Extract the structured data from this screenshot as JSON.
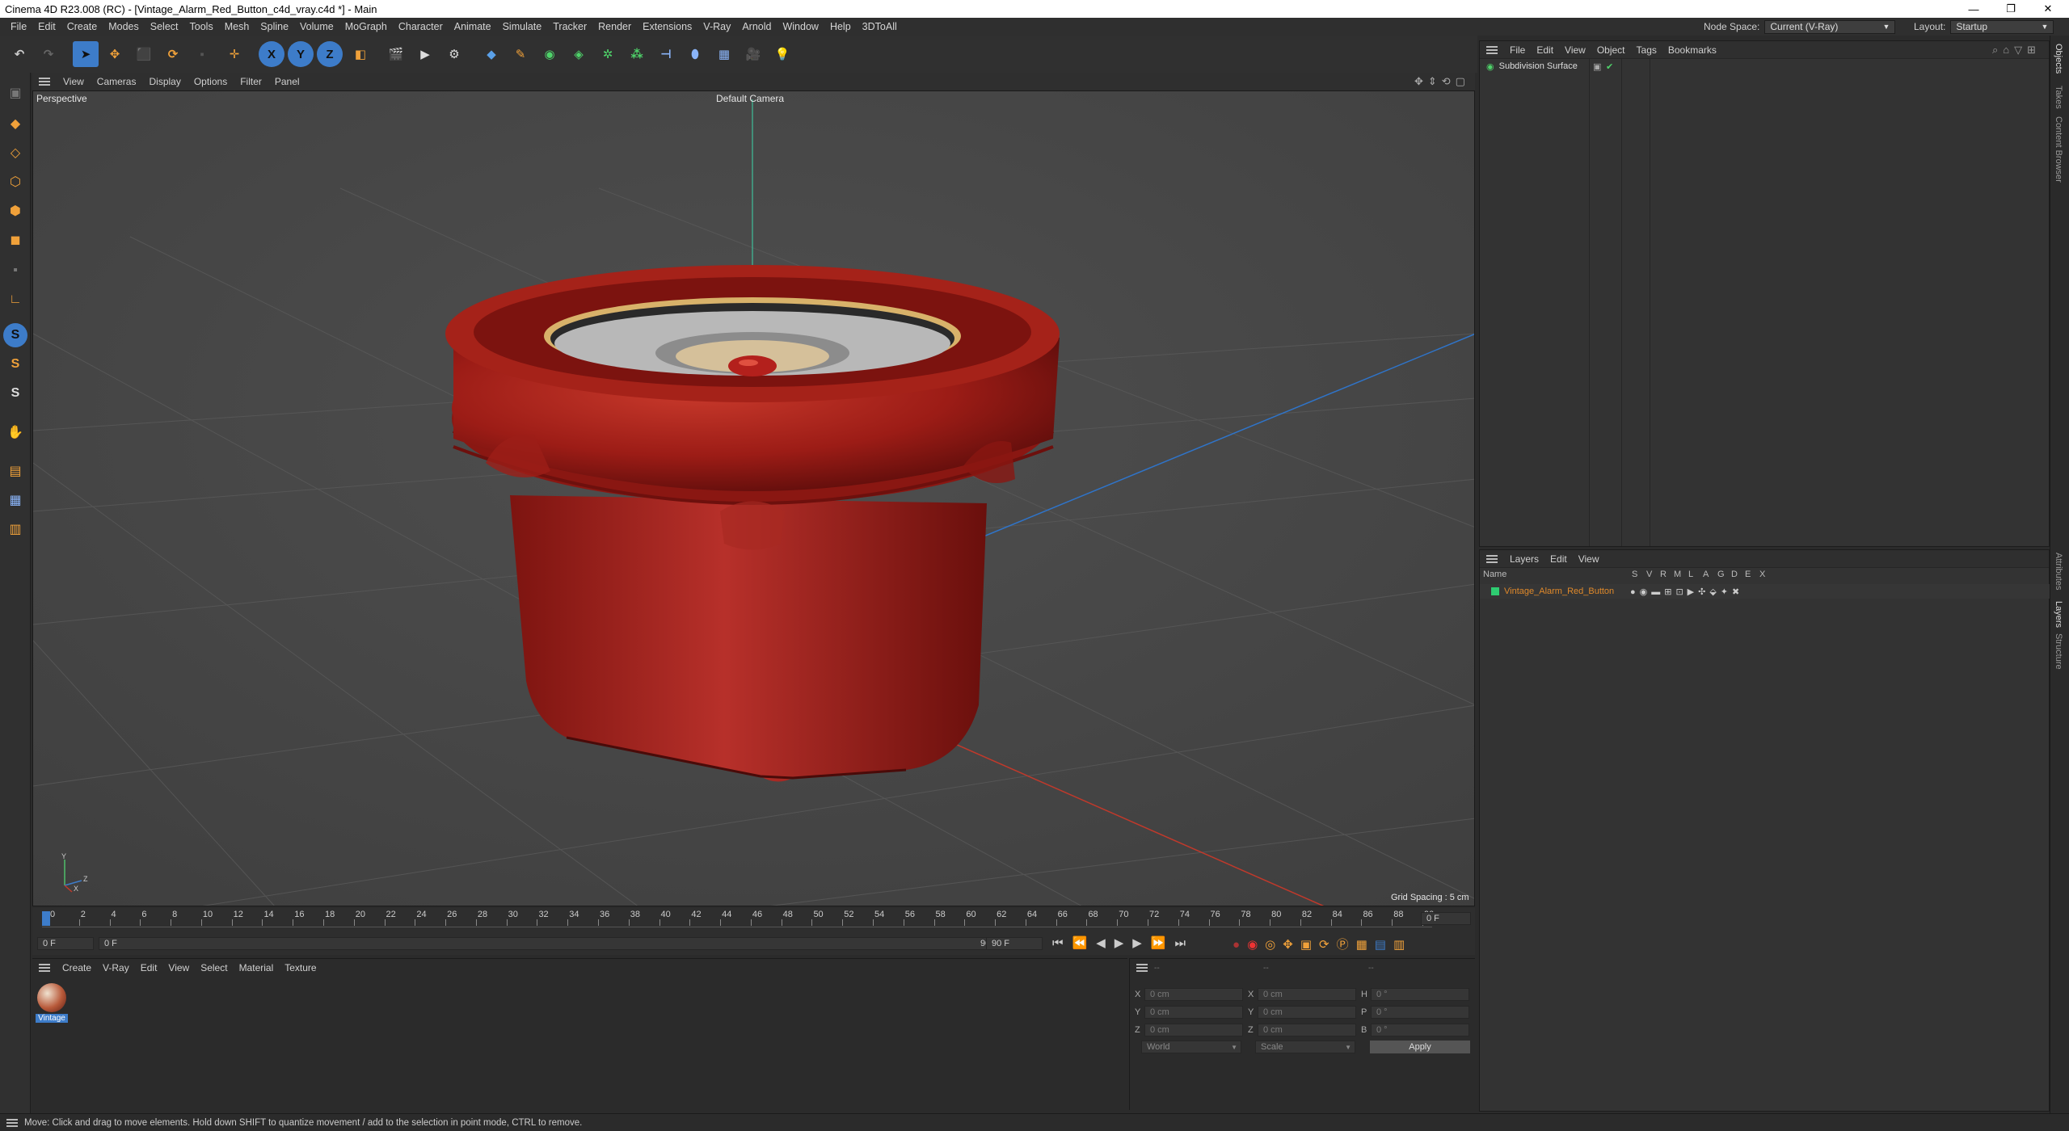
{
  "window": {
    "title": "Cinema 4D R23.008 (RC) - [Vintage_Alarm_Red_Button_c4d_vray.c4d *] - Main",
    "controls": [
      "—",
      "❐",
      "✕"
    ]
  },
  "menubar": {
    "items": [
      "File",
      "Edit",
      "Create",
      "Modes",
      "Select",
      "Tools",
      "Mesh",
      "Spline",
      "Volume",
      "MoGraph",
      "Character",
      "Animate",
      "Simulate",
      "Tracker",
      "Render",
      "Extensions",
      "V-Ray",
      "Arnold",
      "Window",
      "Help",
      "3DToAll"
    ],
    "node_space_label": "Node Space:",
    "node_space_value": "Current (V-Ray)",
    "layout_label": "Layout:",
    "layout_value": "Startup"
  },
  "toolbar": {
    "axis_x": "X",
    "axis_y": "Y",
    "axis_z": "Z"
  },
  "viewport": {
    "menu": [
      "View",
      "Cameras",
      "Display",
      "Options",
      "Filter",
      "Panel"
    ],
    "view_name": "Perspective",
    "camera_label": "Default Camera",
    "grid_spacing": "Grid Spacing : 5 cm",
    "axis_labels": {
      "y": "Y",
      "z": "Z",
      "x": "X"
    }
  },
  "timeline": {
    "ticks": [
      "0",
      "2",
      "4",
      "6",
      "8",
      "10",
      "12",
      "14",
      "16",
      "18",
      "20",
      "22",
      "24",
      "26",
      "28",
      "30",
      "32",
      "34",
      "36",
      "38",
      "40",
      "42",
      "44",
      "46",
      "48",
      "50",
      "52",
      "54",
      "56",
      "58",
      "60",
      "62",
      "64",
      "66",
      "68",
      "70",
      "72",
      "74",
      "76",
      "78",
      "80",
      "82",
      "84",
      "86",
      "88",
      "90"
    ],
    "end_field": "0 F",
    "current_frame": "0 F",
    "start_field": "0 F",
    "range_end_inner": "90 F",
    "range_end": "90 F"
  },
  "material_manager": {
    "menu": [
      "Create",
      "V-Ray",
      "Edit",
      "View",
      "Select",
      "Material",
      "Texture"
    ],
    "materials": [
      {
        "label": "Vintage"
      }
    ]
  },
  "coordinates": {
    "header_dashes": [
      "--",
      "--",
      "--"
    ],
    "rows": [
      {
        "axis": "X",
        "pos": "0 cm",
        "size_axis": "X",
        "size": "0 cm",
        "rot_axis": "H",
        "rot": "0 °"
      },
      {
        "axis": "Y",
        "pos": "0 cm",
        "size_axis": "Y",
        "size": "0 cm",
        "rot_axis": "P",
        "rot": "0 °"
      },
      {
        "axis": "Z",
        "pos": "0 cm",
        "size_axis": "Z",
        "size": "0 cm",
        "rot_axis": "B",
        "rot": "0 °"
      }
    ],
    "mode_world": "World",
    "mode_scale": "Scale",
    "apply": "Apply"
  },
  "object_manager": {
    "menu": [
      "File",
      "Edit",
      "View",
      "Object",
      "Tags",
      "Bookmarks"
    ],
    "objects": [
      {
        "name": "Subdivision Surface"
      }
    ]
  },
  "layer_manager": {
    "menu": [
      "Layers",
      "Edit",
      "View"
    ],
    "columns": [
      "Name",
      "S",
      "V",
      "R",
      "M",
      "L",
      "A",
      "G",
      "D",
      "E",
      "X"
    ],
    "layers": [
      {
        "name": "Vintage_Alarm_Red_Button",
        "color": "#2ecc71"
      }
    ]
  },
  "right_tabs": [
    "Objects",
    "Takes",
    "Content Browser",
    "Attributes",
    "Layers",
    "Structure"
  ],
  "status": "Move: Click and drag to move elements. Hold down SHIFT to quantize movement / add to the selection in point mode, CTRL to remove.",
  "colors": {
    "accent_blue": "#3d7cc9",
    "layer_orange": "#e0892a",
    "object_red": "#b3201c"
  }
}
